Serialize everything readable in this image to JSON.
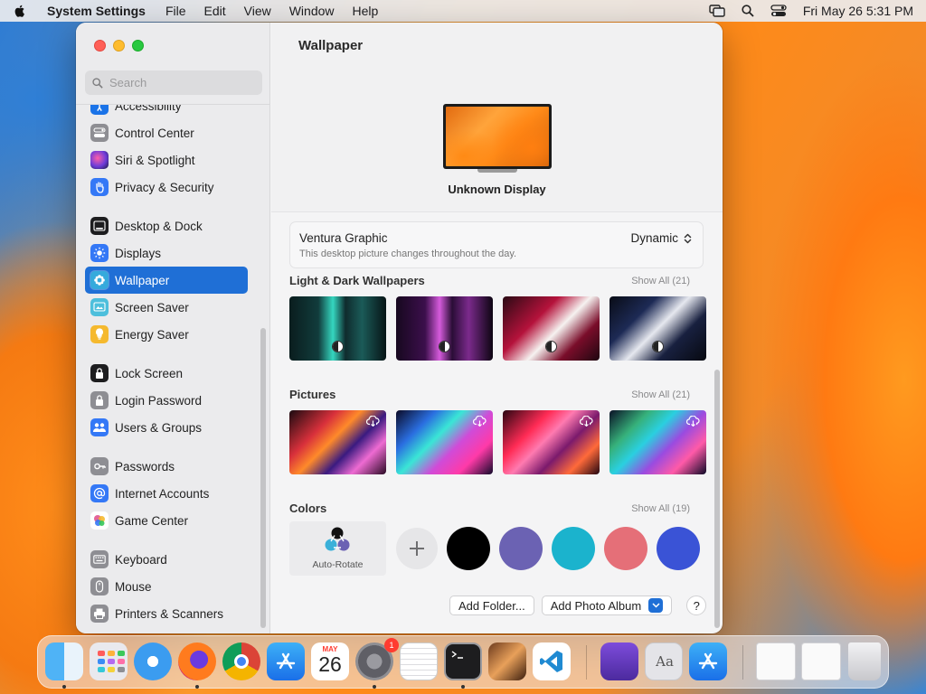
{
  "menubar": {
    "app_name": "System Settings",
    "menus": [
      "File",
      "Edit",
      "View",
      "Window",
      "Help"
    ],
    "clock": "Fri May 26  5:31 PM"
  },
  "window": {
    "search_placeholder": "Search",
    "sidebar": {
      "items": [
        {
          "label": "Accessibility",
          "icon": "accessibility-icon",
          "color": "#1a73e8"
        },
        {
          "label": "Control Center",
          "icon": "control-center-icon",
          "color": "#8e8e93"
        },
        {
          "label": "Siri & Spotlight",
          "icon": "siri-icon",
          "color": "#a24ad6"
        },
        {
          "label": "Privacy & Security",
          "icon": "hand-icon",
          "color": "#3478f6"
        },
        {
          "label": "Desktop & Dock",
          "icon": "desktop-dock-icon",
          "color": "#1d1d1f"
        },
        {
          "label": "Displays",
          "icon": "displays-icon",
          "color": "#3478f6"
        },
        {
          "label": "Wallpaper",
          "icon": "wallpaper-icon",
          "color": "#35aadc"
        },
        {
          "label": "Screen Saver",
          "icon": "screen-saver-icon",
          "color": "#4dbfdc"
        },
        {
          "label": "Energy Saver",
          "icon": "energy-icon",
          "color": "#f5b92e"
        },
        {
          "label": "Lock Screen",
          "icon": "lock-icon",
          "color": "#1d1d1f"
        },
        {
          "label": "Login Password",
          "icon": "login-lock-icon",
          "color": "#8e8e93"
        },
        {
          "label": "Users & Groups",
          "icon": "users-icon",
          "color": "#3478f6"
        },
        {
          "label": "Passwords",
          "icon": "key-icon",
          "color": "#8e8e93"
        },
        {
          "label": "Internet Accounts",
          "icon": "at-icon",
          "color": "#3478f6"
        },
        {
          "label": "Game Center",
          "icon": "game-center-icon",
          "color": "#e0548f"
        },
        {
          "label": "Keyboard",
          "icon": "keyboard-icon",
          "color": "#8e8e93"
        },
        {
          "label": "Mouse",
          "icon": "mouse-icon",
          "color": "#8e8e93"
        },
        {
          "label": "Printers & Scanners",
          "icon": "printer-icon",
          "color": "#8e8e93"
        }
      ],
      "active": "Wallpaper"
    },
    "content": {
      "title": "Wallpaper",
      "display_name": "Unknown Display",
      "current": {
        "name": "Ventura Graphic",
        "description": "This desktop picture changes throughout the day.",
        "mode": "Dynamic"
      },
      "sections": {
        "light_dark": {
          "title": "Light & Dark Wallpapers",
          "show_all": "Show All (21)"
        },
        "pictures": {
          "title": "Pictures",
          "show_all": "Show All (21)"
        },
        "colors": {
          "title": "Colors",
          "show_all": "Show All (19)",
          "auto_rotate": "Auto-Rotate"
        }
      },
      "color_swatches": [
        "#000000",
        "#6b62b3",
        "#1bb3cd",
        "#e56f78",
        "#3a53d6"
      ],
      "buttons": {
        "add_folder": "Add Folder...",
        "add_photo_album": "Add Photo Album",
        "help": "?"
      }
    }
  },
  "dock": {
    "apps": [
      "Finder",
      "Launchpad",
      "Safari",
      "Firefox",
      "Chrome",
      "App Store",
      "Calendar",
      "System Settings",
      "TextEdit",
      "Terminal",
      "GarageBand",
      "Visual Studio Code",
      "Podcast Capture",
      "Font Book",
      "Xcode Store"
    ],
    "calendar_month": "MAY",
    "calendar_day": "26",
    "settings_badge": "1"
  }
}
